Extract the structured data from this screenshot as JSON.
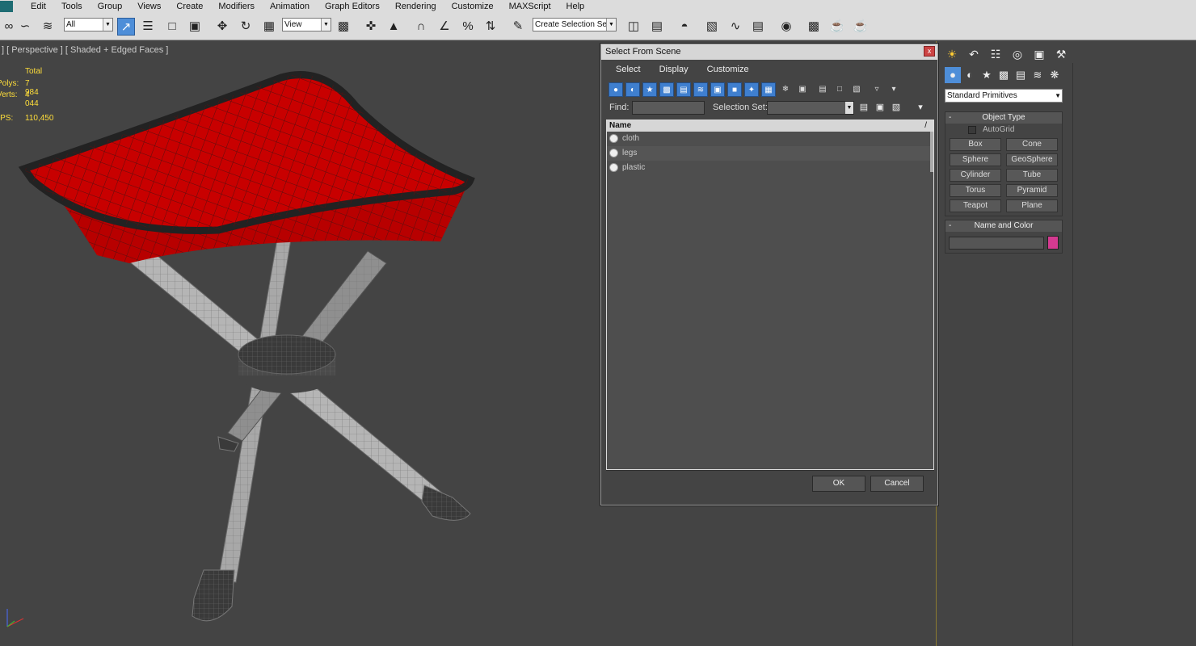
{
  "menu": [
    "Edit",
    "Tools",
    "Group",
    "Views",
    "Create",
    "Modifiers",
    "Animation",
    "Graph Editors",
    "Rendering",
    "Customize",
    "MAXScript",
    "Help"
  ],
  "toolbar": {
    "filter_value": "All",
    "refcoord_value": "View",
    "named_selection_value": "Create Selection Se"
  },
  "viewport": {
    "label": "] [ Perspective ] [ Shaded + Edged Faces ]",
    "stats": {
      "total_label": "Total",
      "polys_label": "Polys:",
      "polys_value": "7 984",
      "verts_label": "Verts:",
      "verts_value": "4 044",
      "fps_label": "FPS:",
      "fps_value": "110,450"
    }
  },
  "command_panel": {
    "primitive_type": "Standard Primitives",
    "object_type": {
      "title": "Object Type",
      "autogrid": "AutoGrid",
      "buttons": [
        "Box",
        "Cone",
        "Sphere",
        "GeoSphere",
        "Cylinder",
        "Tube",
        "Torus",
        "Pyramid",
        "Teapot",
        "Plane"
      ]
    },
    "name_and_color": {
      "title": "Name and Color",
      "name_value": "",
      "color": "#d43a90"
    }
  },
  "dialog": {
    "title": "Select From Scene",
    "close": "x",
    "menu": [
      "Select",
      "Display",
      "Customize"
    ],
    "find_label": "Find:",
    "find_value": "",
    "selection_set_label": "Selection Set:",
    "selection_set_value": "",
    "list_header": "Name",
    "items": [
      "cloth",
      "legs",
      "plastic"
    ],
    "ok": "OK",
    "cancel": "Cancel"
  },
  "colors": {
    "accent": "#4e8ed8",
    "stats_text": "#ffde3a",
    "seat": "#c40000",
    "viewport_bg": "#444444"
  }
}
